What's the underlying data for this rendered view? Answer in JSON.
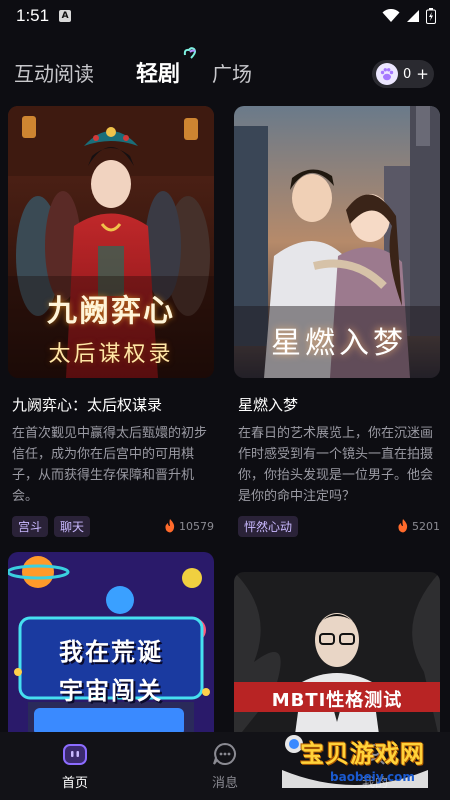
{
  "status": {
    "time": "1:51",
    "notice_icon": "A"
  },
  "tabs": {
    "interactive_reading": "互动阅读",
    "short_drama": "轻剧",
    "plaza": "广场"
  },
  "points": {
    "value": "0",
    "plus": "+"
  },
  "cards": [
    {
      "cover_title_line1": "九阙弈心",
      "cover_title_line2": "太后谋权录",
      "title": "九阙弈心：太后权谋录",
      "desc": "在首次觐见中赢得太后甄嬛的初步信任，成为你在后宫中的可用棋子，从而获得生存保障和晋升机会。",
      "tags": [
        "宫斗",
        "聊天"
      ],
      "heat": "10579"
    },
    {
      "cover_title": "星燃入梦",
      "title": "星燃入梦",
      "desc": "在春日的艺术展览上，你在沉迷画作时感受到有一个镜头一直在拍摄你，你抬头发现是一位男子。他会是你的命中注定吗？",
      "tags": [
        "怦然心动"
      ],
      "heat": "5201"
    },
    {
      "cover_title_line1": "我在荒诞",
      "cover_title_line2": "宇宙闯关"
    },
    {
      "cover_title": "MBTI性格测试"
    }
  ],
  "nav": {
    "home": "首页",
    "messages": "消息",
    "mine": "我的"
  },
  "watermark": {
    "title": "宝贝游戏网",
    "url": "baobeiy.com"
  },
  "colors": {
    "accent": "#7b5cff",
    "tag_text": "#c9b9ff",
    "heat_flame": "#ff6a2b"
  }
}
